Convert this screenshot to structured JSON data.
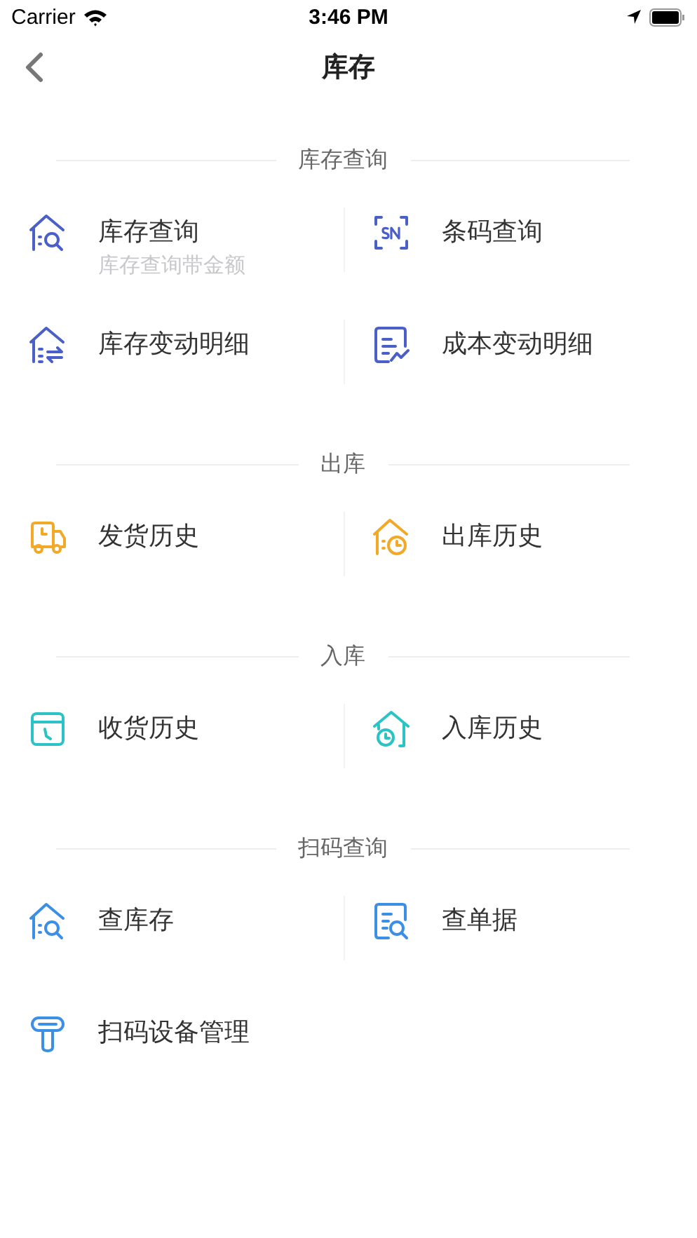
{
  "status_bar": {
    "carrier": "Carrier",
    "time": "3:46 PM"
  },
  "nav": {
    "title": "库存"
  },
  "sections": [
    {
      "title": "库存查询",
      "items": [
        {
          "label": "库存查询",
          "subtitle": "库存查询带金额",
          "kind": "house-search",
          "color": "#4b5fc8"
        },
        {
          "label": "条码查询",
          "kind": "sn-scan",
          "color": "#4b5fc8"
        },
        {
          "label": "库存变动明细",
          "kind": "house-transfer",
          "color": "#4b5fc8"
        },
        {
          "label": "成本变动明细",
          "kind": "doc-chart",
          "color": "#4b5fc8"
        }
      ]
    },
    {
      "title": "出库",
      "items": [
        {
          "label": "发货历史",
          "kind": "truck",
          "color": "#f2a928"
        },
        {
          "label": "出库历史",
          "kind": "house-clock",
          "color": "#f2a928"
        }
      ]
    },
    {
      "title": "入库",
      "items": [
        {
          "label": "收货历史",
          "kind": "box-clock",
          "color": "#2cc3c6"
        },
        {
          "label": "入库历史",
          "kind": "house-clock-alt",
          "color": "#2cc3c6"
        }
      ]
    },
    {
      "title": "扫码查询",
      "items": [
        {
          "label": "查库存",
          "kind": "house-search",
          "color": "#3b8fe4"
        },
        {
          "label": "查单据",
          "kind": "doc-search",
          "color": "#3b8fe4"
        },
        {
          "label": "扫码设备管理",
          "kind": "scanner",
          "color": "#3b8fe4"
        }
      ]
    }
  ]
}
